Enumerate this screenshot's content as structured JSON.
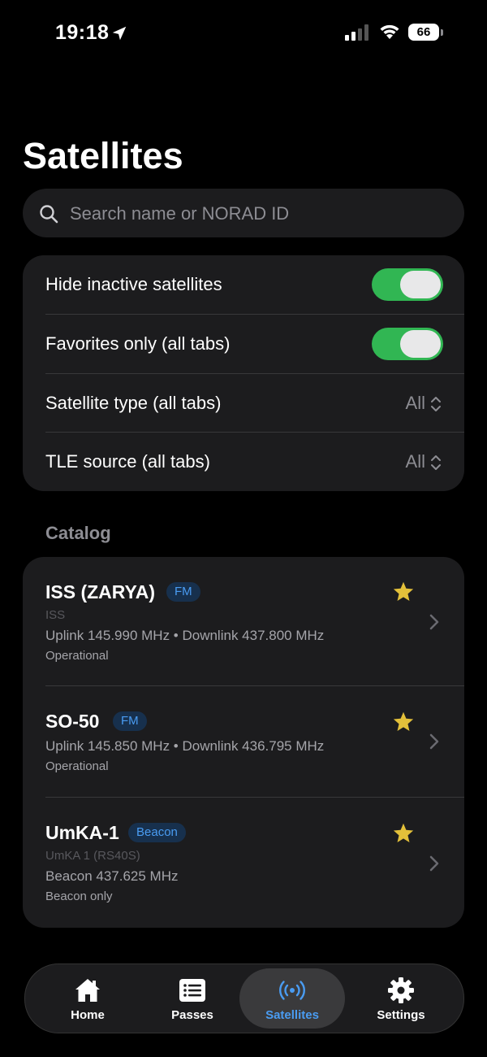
{
  "status_bar": {
    "time": "19:18",
    "battery": "66"
  },
  "page": {
    "title": "Satellites"
  },
  "search": {
    "placeholder": "Search name or NORAD ID",
    "value": ""
  },
  "filters": {
    "hide_inactive": {
      "label": "Hide inactive satellites",
      "on": true
    },
    "favorites_only": {
      "label": "Favorites only (all tabs)",
      "on": true
    },
    "satellite_type": {
      "label": "Satellite type (all tabs)",
      "value": "All"
    },
    "tle_source": {
      "label": "TLE source (all tabs)",
      "value": "All"
    }
  },
  "catalog": {
    "title": "Catalog",
    "items": [
      {
        "name": "ISS (ZARYA)",
        "badge": "FM",
        "alias": "ISS",
        "freq": "Uplink 145.990 MHz • Downlink 437.800 MHz",
        "status": "Operational",
        "favorite": true
      },
      {
        "name": "SO-50",
        "badge": "FM",
        "alias": "",
        "freq": "Uplink 145.850 MHz • Downlink 436.795 MHz",
        "status": "Operational",
        "favorite": true
      },
      {
        "name": "UmKA-1",
        "badge": "Beacon",
        "alias": "UmKA 1 (RS40S)",
        "freq": "Beacon 437.625 MHz",
        "status": "Beacon only",
        "favorite": true
      }
    ]
  },
  "tabbar": {
    "tabs": [
      {
        "label": "Home",
        "icon": "home-icon"
      },
      {
        "label": "Passes",
        "icon": "list-icon"
      },
      {
        "label": "Satellites",
        "icon": "antenna-icon",
        "active": true
      },
      {
        "label": "Settings",
        "icon": "gear-icon"
      }
    ]
  },
  "colors": {
    "accent": "#4a9cf2",
    "toggle_on": "#34c759",
    "star": "#e3c03a",
    "card": "#1c1c1e"
  }
}
